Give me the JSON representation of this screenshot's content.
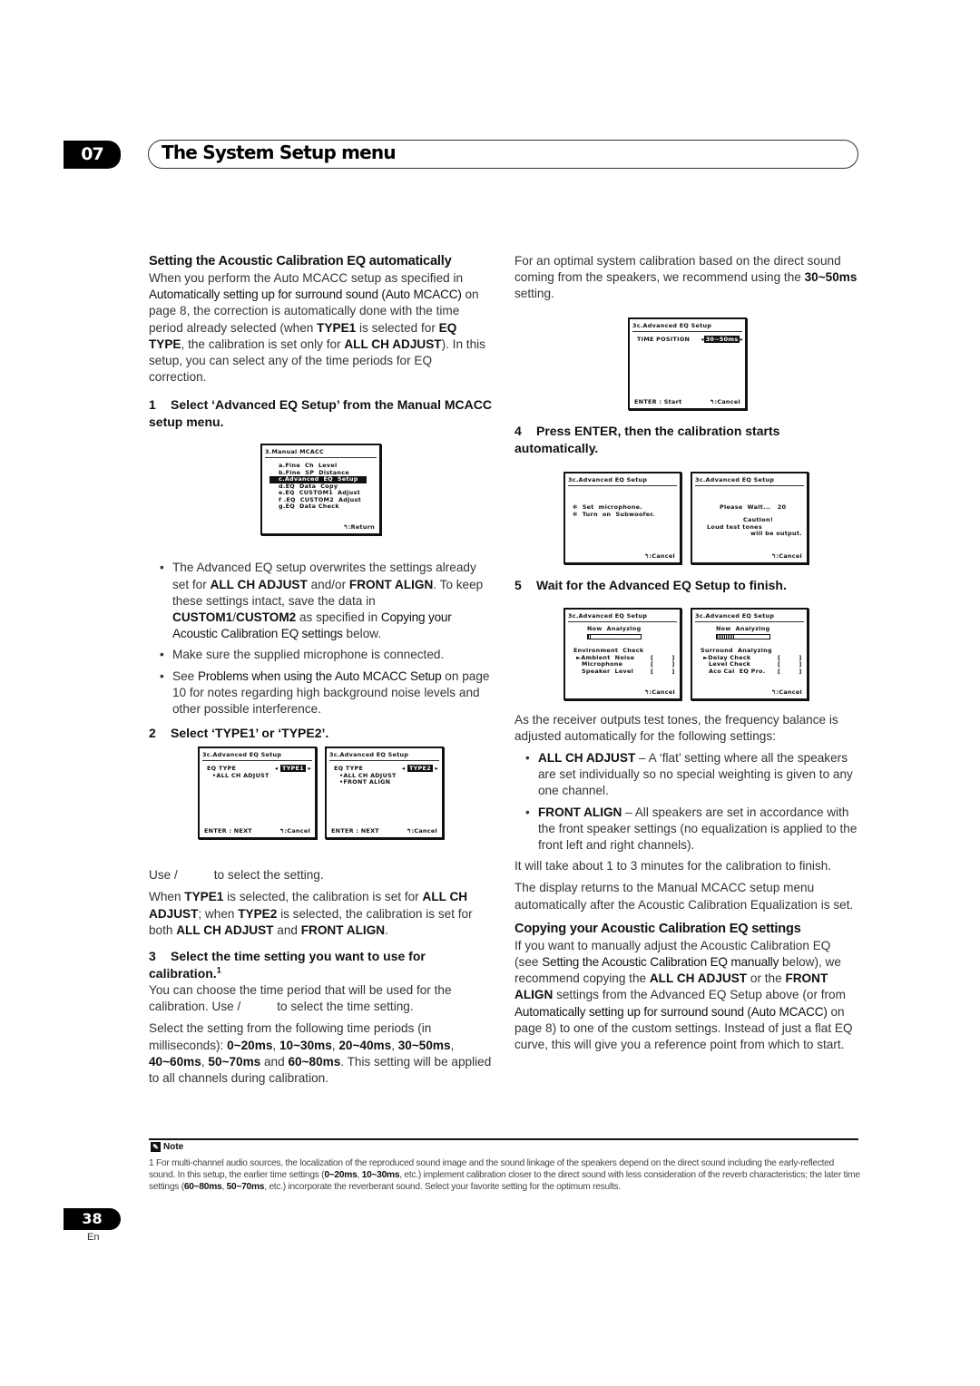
{
  "header": {
    "chapter_number": "07",
    "chapter_title": "The System Setup menu"
  },
  "left": {
    "section_title": "Setting the Acoustic Calibration EQ automatically",
    "intro": {
      "t1": "When you perform the Auto MCACC setup as specified in ",
      "ref1": "Automatically setting up for surround sound (Auto MCACC)",
      "t2": " on page 8, the correction is automatically done with the time period already selected (when ",
      "b1": "TYPE1",
      "t3": " is selected for ",
      "b2": "EQ TYPE",
      "t4": ", the calibration is set only for ",
      "b3": "ALL CH ADJUST",
      "t5": "). In this setup, you can select any of the time periods for EQ correction."
    },
    "step1": {
      "number": "1",
      "text": "Select ‘Advanced EQ Setup’ from the Manual MCACC setup menu."
    },
    "bullets1": {
      "b1": {
        "t1": "The Advanced EQ setup overwrites the settings already set for ",
        "b1": "ALL CH ADJUST",
        "t2": " and/or ",
        "b2": "FRONT ALIGN",
        "t3": ". To keep these settings intact, save the data in ",
        "b3": "CUSTOM1",
        "t4": "/",
        "b4": "CUSTOM2",
        "t5": " as specified in ",
        "ref": "Copying your Acoustic Calibration EQ settings",
        "t6": " below."
      },
      "b2": {
        "t1": "Make sure the supplied microphone is connected."
      },
      "b3": {
        "t1": "See ",
        "ref": "Problems when using the Auto MCACC Setup",
        "t2": " on page 10 for notes regarding high background noise levels and other possible interference."
      }
    },
    "step2": {
      "number": "2",
      "text": "Select ‘TYPE1’ or ‘TYPE2’."
    },
    "use_line": {
      "t1": "Use ",
      "sep": "/",
      "t2": "to select the setting."
    },
    "type_para": {
      "t1": "When ",
      "b1": "TYPE1",
      "t2": " is selected, the calibration is set for ",
      "b2": "ALL CH ADJUST",
      "t3": "; when ",
      "b3": "TYPE2",
      "t4": " is selected, the calibration is set for both ",
      "b4": "ALL CH ADJUST",
      "t5": " and ",
      "b5": "FRONT ALIGN",
      "t6": "."
    },
    "step3": {
      "number": "3",
      "text": "Select the time setting you want to use for calibration.",
      "footnote_ref": "1"
    },
    "step3_para1": {
      "t1": "You can choose the time period that will be used for the calibration. Use ",
      "sep": "/",
      "t2": "to select the time setting."
    },
    "step3_para2": {
      "t1": "Select the setting from the following time periods (in milliseconds): ",
      "periods": [
        "0~20ms",
        "10~30ms",
        "20~40ms",
        "30~50ms",
        "40~60ms",
        "50~70ms",
        "60~80ms"
      ],
      "c": ", ",
      "and": " and ",
      "t2": ". This setting will be applied to all channels during calibration."
    }
  },
  "right": {
    "para1": {
      "t1": "For an optimal system calibration based on the direct sound coming from the speakers, we recommend using the ",
      "b1": "30~50ms",
      "t2": " setting."
    },
    "step4": {
      "number": "4",
      "text": "Press ENTER, then the calibration starts automatically."
    },
    "step5": {
      "number": "5",
      "text": "Wait for the Advanced EQ Setup to finish."
    },
    "para2": "As the receiver outputs test tones, the frequency balance is adjusted automatically for the following settings:",
    "bullets": {
      "b1": {
        "b": "ALL CH ADJUST",
        "t": " – A ‘flat’ setting where all the speakers are set individually so no special weighting is given to any one channel."
      },
      "b2": {
        "b": "FRONT ALIGN",
        "t": " – All speakers are set in accordance with the front speaker settings (no equalization is applied to the front left and right channels)."
      }
    },
    "para3": "It will take about 1 to 3 minutes for the calibration to finish.",
    "para4": "The display returns to the Manual MCACC setup menu automatically after the Acoustic Calibration Equalization is set.",
    "section2_title": "Copying your Acoustic Calibration EQ settings",
    "section2": {
      "t1": "If you want to manually adjust the Acoustic Calibration EQ (see ",
      "ref1": "Setting the Acoustic Calibration EQ manually",
      "t2": " below), we recommend copying the ",
      "b1": "ALL CH ADJUST",
      "t3": " or the ",
      "b2": "FRONT ALIGN",
      "t4": " settings from the Advanced EQ Setup above (or from ",
      "ref2": "Automatically setting up for surround sound (Auto MCACC)",
      "t5": " on page 8) to one of the custom settings. Instead of just a flat EQ curve, this will give you a reference point from which to start."
    }
  },
  "screens": {
    "manual_mcacc": {
      "title": "3.Manual  MCACC",
      "items": [
        "a.Fine  Ch  Level",
        "b.Fine  SP  Distance",
        "c.Advanced  EQ  Setup",
        "d.EQ  Data  Copy",
        "e.EQ  CUSTOM1  Adjust",
        "f .EQ  CUSTOM2  Adjust",
        "g.EQ  Data Check"
      ],
      "selected_index": 2,
      "footer_right": ":Return"
    },
    "type1": {
      "title": "3c.Advanced EQ Setup",
      "label": "EQ TYPE",
      "value": "TYPE1",
      "items": [
        "•ALL CH ADJUST"
      ],
      "footer_left": "ENTER : NEXT",
      "footer_right": ":Cancel"
    },
    "type2": {
      "title": "3c.Advanced EQ Setup",
      "label": "EQ TYPE",
      "value": "TYPE2",
      "items": [
        "•ALL CH ADJUST",
        "•FRONT ALIGN"
      ],
      "footer_left": "ENTER : NEXT",
      "footer_right": ":Cancel"
    },
    "time": {
      "title": "3c.Advanced EQ Setup",
      "label": "TIME POSITION",
      "value": "30~50ms",
      "footer_left": "ENTER : Start",
      "footer_right": ":Cancel"
    },
    "start": {
      "title": "3c.Advanced EQ Setup",
      "items": [
        "✻  Set  microphone.",
        "✻  Turn  on  Subwoofer."
      ],
      "footer_right": ":Cancel"
    },
    "wait": {
      "title": "3c.Advanced EQ Setup",
      "wait": "Please  Wait...   20",
      "caution": "Caution!",
      "l1": "Loud test tones",
      "l2": "will be output.",
      "footer_right": ":Cancel"
    },
    "analyze1": {
      "title": "3c.Advanced EQ Setup",
      "status": "Now  Analyzing",
      "progress": 0.05,
      "group": "Environment  Check",
      "items": [
        "►Ambient  Noise",
        "Microphone",
        "Speaker  Level"
      ],
      "bracket": "[        ]",
      "footer_right": ":Cancel"
    },
    "analyze2": {
      "title": "3c.Advanced EQ Setup",
      "status": "Now  Analyzing",
      "progress": 0.35,
      "group": "Surround  Analyzing",
      "items": [
        "►Delay Check",
        "Level Check",
        "Aco Cal  EQ Pro."
      ],
      "bracket": "[        ]",
      "footer_right": ":Cancel"
    },
    "return_icon": "↰"
  },
  "note": {
    "label": "Note",
    "number": "1",
    "t1": " For multi-channel audio sources, the localization of the reproduced sound image and the sound linkage of the speakers depend on the direct sound including the early-reflected sound. In this setup, the earlier time settings (",
    "b1": "0~20ms",
    "c1": ", ",
    "b2": "10~30ms",
    "t2": ", etc.) implement calibration closer to the direct sound with less consideration of the reverb characteristics; the later time settings (",
    "b3": "60~80ms",
    "c2": ", ",
    "b4": "50~70ms",
    "t3": ", etc.) incorporate the reverberant sound. Select your favorite setting for the optimum results."
  },
  "footer": {
    "page_number": "38",
    "language": "En"
  }
}
